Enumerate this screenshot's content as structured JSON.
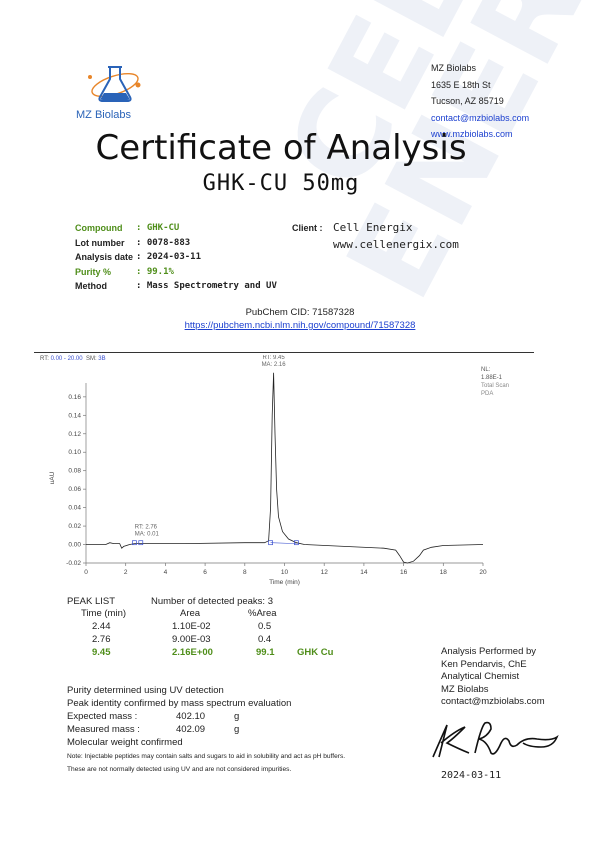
{
  "watermark": [
    "CELL",
    "ENERGIX"
  ],
  "company": {
    "logo_text": "MZ Biolabs",
    "address": [
      "MZ Biolabs",
      "1635 E 18th St",
      "Tucson, AZ 85719"
    ],
    "email": "contact@mzbiolabs.com",
    "website": "www.mzbiolabs.com"
  },
  "title": "Certificate of Analysis",
  "subtitle": "GHK-CU  50mg",
  "info": {
    "compound_label": "Compound",
    "compound_value": ": GHK-CU",
    "lot_label": "Lot number",
    "lot_value": ": 0078-883",
    "date_label": "Analysis date",
    "date_value": ": 2024-03-11",
    "purity_label": "Purity %",
    "purity_value": ": 99.1%",
    "method_label": "Method",
    "method_value": ": Mass Spectrometry and UV"
  },
  "client": {
    "label": "Client :",
    "name": "Cell Energix",
    "website": "www.cellenergix.com"
  },
  "pubchem": {
    "cid": "PubChem CID: 71587328",
    "url": "https://pubchem.ncbi.nlm.nih.gov/compound/71587328"
  },
  "chart_header": {
    "rt_label": "RT:",
    "rt_range": "0.00 - 20.00",
    "sm_label": "SM:",
    "sm_value": "3B",
    "nl_lines": [
      "NL:",
      "1.88E-1",
      "Total Scan",
      "PDA"
    ]
  },
  "chart_data": {
    "type": "line",
    "xlabel": "Time (min)",
    "ylabel": "uAU",
    "xlim": [
      0,
      20
    ],
    "ylim": [
      -0.02,
      0.175
    ],
    "xticks": [
      0,
      2,
      4,
      6,
      8,
      10,
      12,
      14,
      16,
      18,
      20
    ],
    "yticks": [
      -0.02,
      0.0,
      0.02,
      0.04,
      0.06,
      0.08,
      0.1,
      0.12,
      0.14,
      0.16
    ],
    "ytick_labels": [
      "-0.02",
      "0.00",
      "0.02",
      "0.04",
      "0.06",
      "0.08",
      "0.10",
      "0.12",
      "0.14",
      "0.16"
    ],
    "trace": {
      "x": [
        0,
        1.0,
        1.2,
        1.4,
        1.7,
        1.8,
        1.9,
        2.2,
        2.44,
        2.76,
        3.0,
        5.0,
        8.0,
        9.0,
        9.2,
        9.3,
        9.38,
        9.45,
        9.52,
        9.6,
        9.7,
        9.9,
        10.2,
        10.6,
        11.0,
        13.0,
        15.0,
        15.6,
        15.8,
        16.0,
        16.2,
        16.5,
        16.8,
        17.0,
        17.4,
        18.0,
        20.0
      ],
      "y": [
        0.0,
        0.0,
        0.002,
        0.001,
        0.001,
        -0.004,
        -0.002,
        0.0,
        0.001,
        0.001,
        0.001,
        0.001,
        0.002,
        0.002,
        0.004,
        0.04,
        0.14,
        0.186,
        0.12,
        0.06,
        0.03,
        0.014,
        0.006,
        0.002,
        0.0,
        -0.002,
        -0.004,
        -0.006,
        -0.012,
        -0.019,
        -0.02,
        -0.018,
        -0.012,
        -0.006,
        -0.003,
        -0.001,
        0.0
      ]
    },
    "annotations": [
      {
        "x": 9.45,
        "y": 0.186,
        "lines": [
          "RT: 9.45",
          "MA: 2.16"
        ]
      },
      {
        "x": 2.76,
        "y": 0.002,
        "lines": [
          "RT: 2.76",
          "MA: 0.01"
        ]
      }
    ],
    "peak_markers_x": [
      2.44,
      2.76,
      9.3,
      10.6
    ]
  },
  "peak_list": {
    "title": "PEAK LIST",
    "detected": "Number of detected peaks: 3",
    "headers": [
      "Time (min)",
      "Area",
      "%Area"
    ],
    "rows": [
      {
        "time": "2.44",
        "area": "1.10E-02",
        "pct": "0.5",
        "name": ""
      },
      {
        "time": "2.76",
        "area": "9.00E-03",
        "pct": "0.4",
        "name": ""
      },
      {
        "time": "9.45",
        "area": "2.16E+00",
        "pct": "99.1",
        "name": "GHK Cu"
      }
    ]
  },
  "notes": {
    "line1": "Purity determined using UV detection",
    "line2": "Peak identity confirmed by mass spectrum evaluation",
    "expected_label": "Expected mass :",
    "expected_value": "402.10",
    "expected_unit": "g",
    "measured_label": "Measured mass :",
    "measured_value": "402.09",
    "measured_unit": "g",
    "line3": "Molecular weight confirmed",
    "fine1": "Note: Injectable peptides may contain salts and sugars to aid in solubility and act as pH buffers.",
    "fine2": "These are not normally detected using UV and are not considered impurities."
  },
  "performed": {
    "lines": [
      "Analysis Performed by",
      "Ken Pendarvis, ChE",
      "Analytical Chemist",
      "MZ Biolabs",
      "contact@mzbiolabs.com"
    ],
    "date": "2024-03-11"
  },
  "colors": {
    "green": "#4f8e1a",
    "link": "#1b3fcf",
    "logo_blue": "#2a63b8",
    "logo_orange": "#e8862a",
    "marker_blue": "#3a4fcf"
  }
}
